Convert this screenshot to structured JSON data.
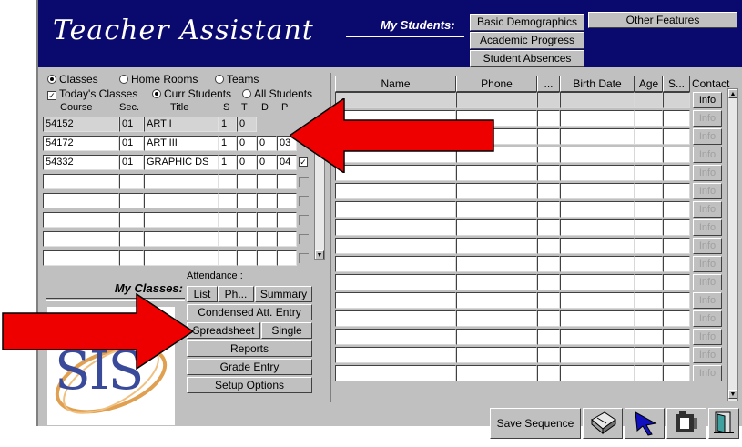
{
  "header": {
    "title": "Teacher Assistant",
    "my_students_label": "My Students:",
    "buttons": [
      "Basic Demographics",
      "Academic Progress",
      "Student Absences"
    ],
    "other_features": "Other Features"
  },
  "filters": {
    "classes": "Classes",
    "home_rooms": "Home Rooms",
    "teams": "Teams",
    "todays_classes": "Today's Classes",
    "curr_students": "Curr Students",
    "all_students": "All Students"
  },
  "class_table": {
    "headers": {
      "course": "Course",
      "sec": "Sec.",
      "title": "Title",
      "s": "S",
      "t": "T",
      "d": "D",
      "p": "P"
    },
    "rows": [
      {
        "course": "54152",
        "sec": "01",
        "title": "ART I",
        "s": "1",
        "t": "0",
        "d": "",
        "p": ""
      },
      {
        "course": "54172",
        "sec": "01",
        "title": "ART III",
        "s": "1",
        "t": "0",
        "d": "0",
        "p": "03"
      },
      {
        "course": "54332",
        "sec": "01",
        "title": "GRAPHIC DS",
        "s": "1",
        "t": "0",
        "d": "0",
        "p": "04"
      }
    ]
  },
  "my_classes": {
    "label": "My Classes:",
    "logo_text": "SIS",
    "attendance_label": "Attendance :",
    "list": "List",
    "ph": "Ph...",
    "summary": "Summary",
    "condensed": "Condensed Att. Entry",
    "spreadsheet": "Spreadsheet",
    "single": "Single",
    "reports": "Reports",
    "grade_entry": "Grade Entry",
    "setup_options": "Setup Options"
  },
  "student_grid": {
    "headers": [
      "Name",
      "Phone",
      "...",
      "Birth Date",
      "Age",
      "S...",
      "Contact"
    ],
    "info_label": "Info",
    "row_count": 16
  },
  "footer": {
    "save_sequence": "Save Sequence"
  },
  "colors": {
    "header_bg": "#0a0a6e",
    "window_bg": "#c0c0c0",
    "arrow_red": "#ee0000"
  }
}
